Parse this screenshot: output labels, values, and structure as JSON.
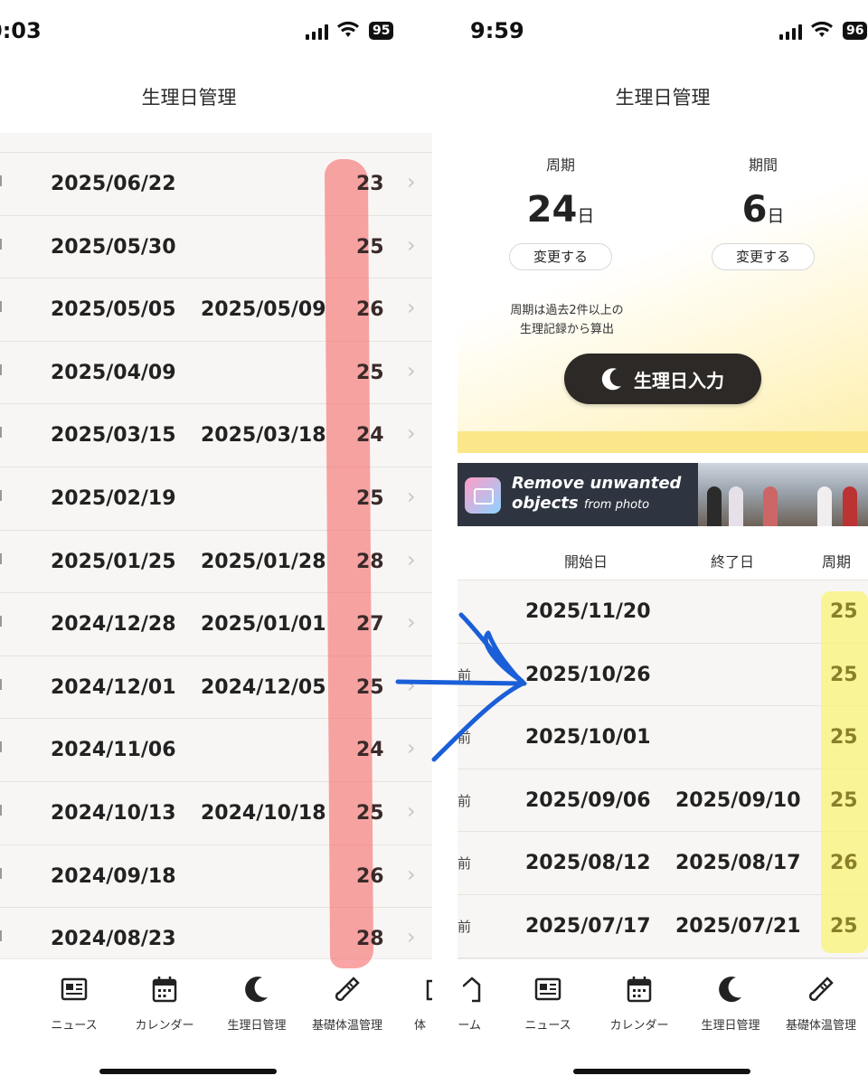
{
  "left": {
    "status": {
      "time": "0:03",
      "battery": "95"
    },
    "title": "生理日管理",
    "rows": [
      {
        "start": "2025/06/22",
        "end": "",
        "cycle": "23"
      },
      {
        "start": "2025/05/30",
        "end": "",
        "cycle": "25"
      },
      {
        "start": "2025/05/05",
        "end": "2025/05/09",
        "cycle": "26"
      },
      {
        "start": "2025/04/09",
        "end": "",
        "cycle": "25"
      },
      {
        "start": "2025/03/15",
        "end": "2025/03/18",
        "cycle": "24"
      },
      {
        "start": "2025/02/19",
        "end": "",
        "cycle": "25"
      },
      {
        "start": "2025/01/25",
        "end": "2025/01/28",
        "cycle": "28"
      },
      {
        "start": "2024/12/28",
        "end": "2025/01/01",
        "cycle": "27"
      },
      {
        "start": "2024/12/01",
        "end": "2024/12/05",
        "cycle": "25"
      },
      {
        "start": "2024/11/06",
        "end": "",
        "cycle": "24"
      },
      {
        "start": "2024/10/13",
        "end": "2024/10/18",
        "cycle": "25"
      },
      {
        "start": "2024/09/18",
        "end": "",
        "cycle": "26"
      },
      {
        "start": "2024/08/23",
        "end": "",
        "cycle": "28"
      }
    ],
    "tabs": [
      "ニュース",
      "カレンダー",
      "生理日管理",
      "基礎体温管理",
      "体"
    ]
  },
  "right": {
    "status": {
      "time": "9:59",
      "battery": "96"
    },
    "title": "生理日管理",
    "summary": {
      "cycle_label": "周期",
      "cycle_value": "24",
      "cycle_unit": "日",
      "period_label": "期間",
      "period_value": "6",
      "period_unit": "日",
      "change_label": "変更する",
      "note_line1": "周期は過去2件以上の",
      "note_line2": "生理記録から算出",
      "input_button": "生理日入力"
    },
    "ad": {
      "line1": "Remove unwanted",
      "line2": "objects",
      "line2_small": "from photo"
    },
    "table": {
      "headers": {
        "start": "開始日",
        "end": "終了日",
        "cycle": "周期"
      },
      "rows": [
        {
          "prefix": "",
          "start": "2025/11/20",
          "end": "",
          "cycle": "25"
        },
        {
          "prefix": "前",
          "start": "2025/10/26",
          "end": "",
          "cycle": "25"
        },
        {
          "prefix": "前",
          "start": "2025/10/01",
          "end": "",
          "cycle": "25"
        },
        {
          "prefix": "前",
          "start": "2025/09/06",
          "end": "2025/09/10",
          "cycle": "25"
        },
        {
          "prefix": "前",
          "start": "2025/08/12",
          "end": "2025/08/17",
          "cycle": "26"
        },
        {
          "prefix": "前",
          "start": "2025/07/17",
          "end": "2025/07/21",
          "cycle": "25"
        }
      ]
    },
    "tabs": [
      "ーム",
      "ニュース",
      "カレンダー",
      "生理日管理",
      "基礎体温管理"
    ]
  }
}
